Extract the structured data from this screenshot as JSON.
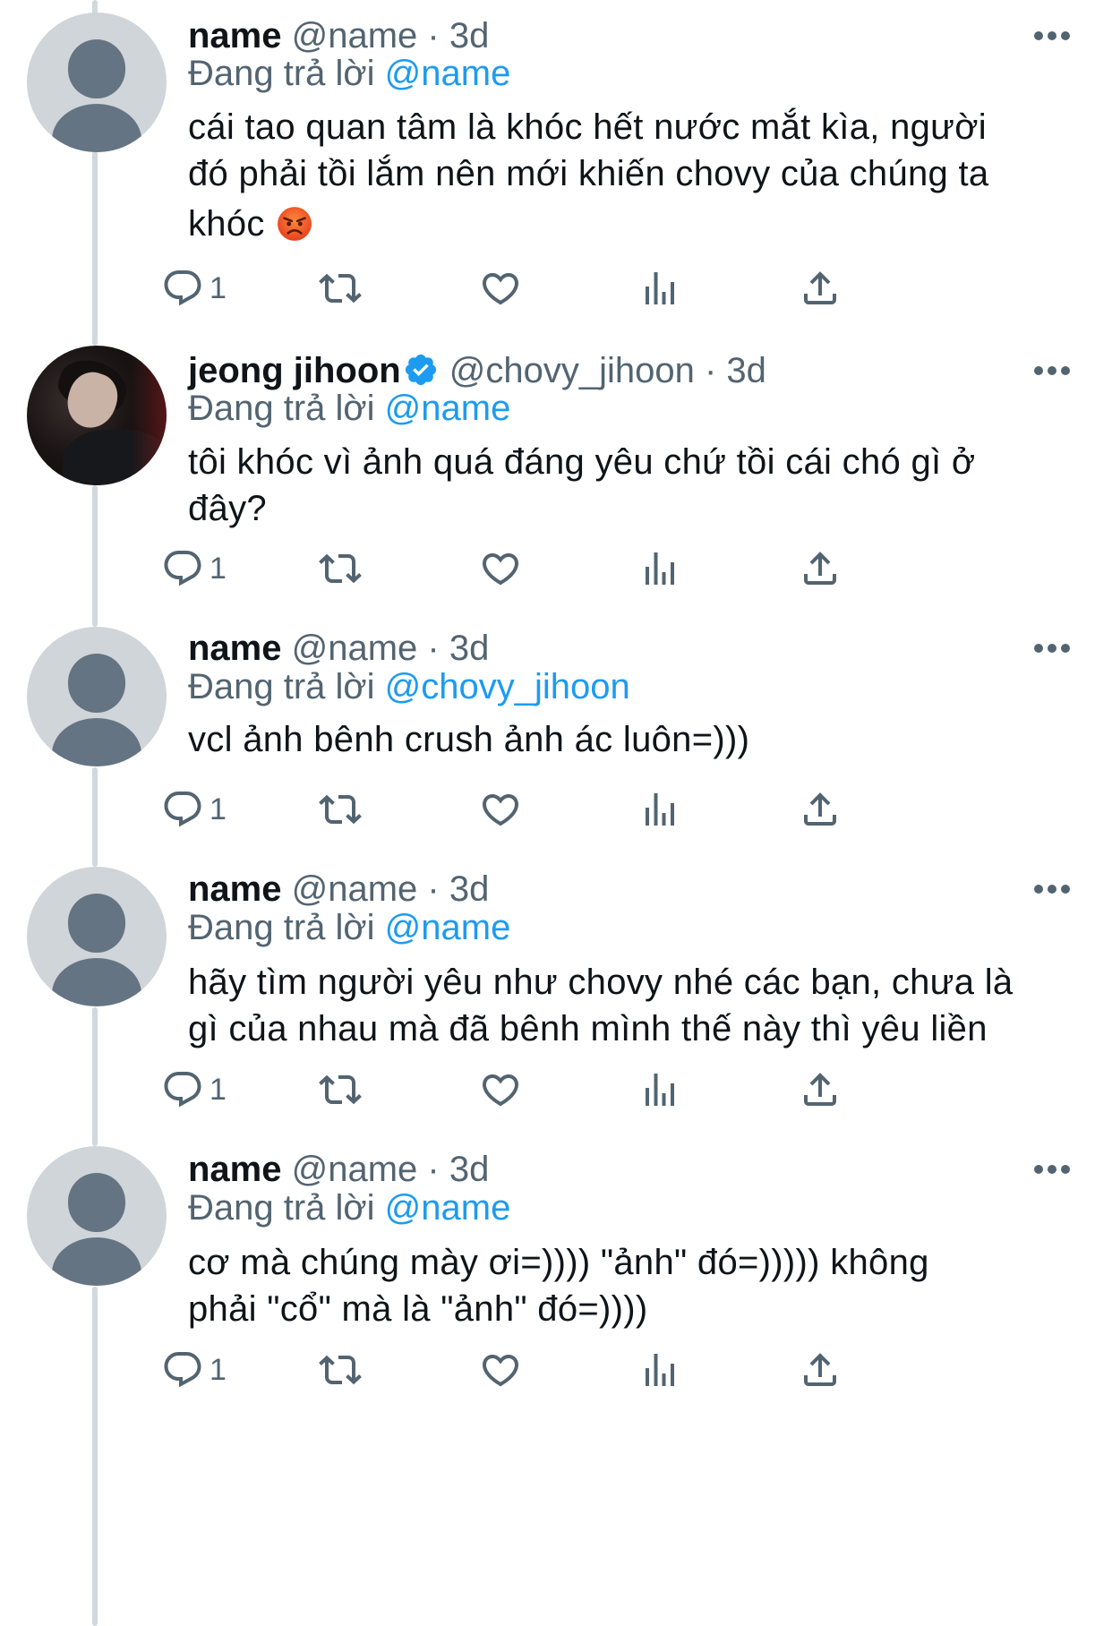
{
  "ui": {
    "reply_prefix": "Đang trả lời",
    "dot": "·",
    "colors": {
      "link": "#1d9bf0",
      "muted": "#536471",
      "text": "#0f1419"
    }
  },
  "tweets": [
    {
      "name": "name",
      "handle": "@name",
      "time": "3d",
      "reply_to": "@name",
      "lines": [
        "cái tao quan tâm là khóc hết nước mắt kìa, người",
        "đó phải tồi lắm nên mới khiến chovy của chúng ta",
        "khóc"
      ],
      "emoji": "angry-face",
      "reply_count": "1",
      "avatar": "default-avatar"
    },
    {
      "name": "jeong jihoon",
      "handle": "@chovy_jihoon",
      "time": "3d",
      "reply_to": "@name",
      "verified": true,
      "lines": [
        "tôi khóc vì ảnh quá đáng yêu chứ tồi cái chó gì ở",
        "đây?"
      ],
      "reply_count": "1",
      "avatar": "profile-photo"
    },
    {
      "name": "name",
      "handle": "@name",
      "time": "3d",
      "reply_to": "@chovy_jihoon",
      "lines": [
        "vcl ảnh bênh crush ảnh ác luôn=)))"
      ],
      "reply_count": "1",
      "avatar": "default-avatar"
    },
    {
      "name": "name",
      "handle": "@name",
      "time": "3d",
      "reply_to": "@name",
      "lines": [
        "hãy tìm người yêu như chovy nhé các bạn, chưa là",
        "gì của nhau mà đã bênh mình thế này thì yêu liền"
      ],
      "reply_count": "1",
      "avatar": "default-avatar"
    },
    {
      "name": "name",
      "handle": "@name",
      "time": "3d",
      "reply_to": "@name",
      "lines": [
        "cơ mà chúng mày ơi=)))) \"ảnh\" đó=))))) không",
        "phải \"cổ\" mà là \"ảnh\" đó=))))"
      ],
      "reply_count": "1",
      "avatar": "default-avatar"
    }
  ]
}
